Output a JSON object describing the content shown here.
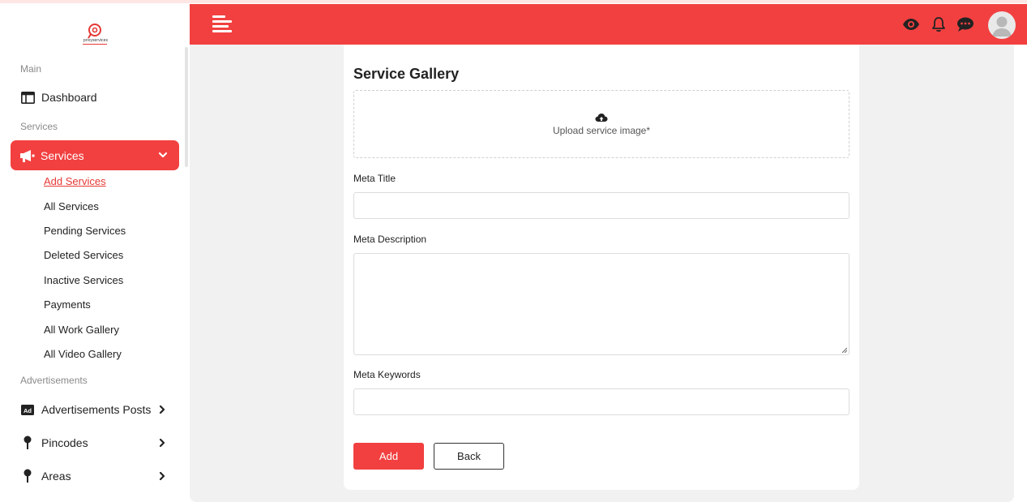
{
  "brand": {
    "logo_text": "privyservices",
    "accent_color": "#f24040"
  },
  "sidebar": {
    "sections": {
      "main": "Main",
      "services": "Services",
      "advertisements": "Advertisements"
    },
    "dashboard": {
      "label": "Dashboard",
      "icon": "dashboard-icon"
    },
    "services_menu": {
      "label": "Services",
      "icon": "megaphone-icon",
      "expanded": true,
      "items": [
        {
          "label": "Add Services",
          "active": true
        },
        {
          "label": "All Services"
        },
        {
          "label": "Pending Services"
        },
        {
          "label": "Deleted Services"
        },
        {
          "label": "Inactive Services"
        },
        {
          "label": "Payments"
        },
        {
          "label": "All Work Gallery"
        },
        {
          "label": "All Video Gallery"
        }
      ]
    },
    "advertisements_posts": {
      "label": "Advertisements Posts",
      "icon": "ad-icon"
    },
    "pincodes": {
      "label": "Pincodes",
      "icon": "map-pin-icon"
    },
    "areas": {
      "label": "Areas",
      "icon": "map-pin-icon"
    }
  },
  "header": {
    "icons": [
      "menu-toggle-icon",
      "eye-icon",
      "bell-icon",
      "chat-icon",
      "user-avatar"
    ]
  },
  "form": {
    "title": "Service Gallery",
    "upload": {
      "text": "Upload service image*",
      "icon": "cloud-upload-icon"
    },
    "meta_title": {
      "label": "Meta Title",
      "value": ""
    },
    "meta_description": {
      "label": "Meta Description",
      "value": ""
    },
    "meta_keywords": {
      "label": "Meta Keywords",
      "value": ""
    },
    "add_button": "Add",
    "back_button": "Back"
  }
}
